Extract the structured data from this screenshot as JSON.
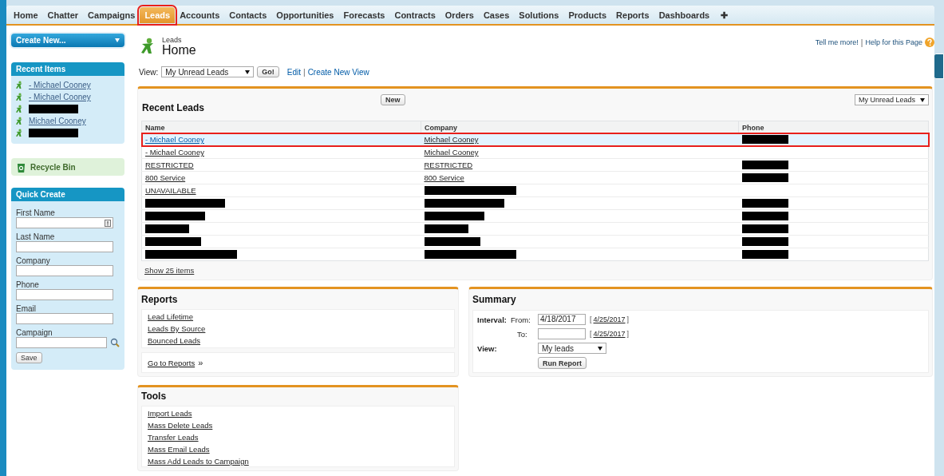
{
  "tabs": [
    {
      "label": "Home",
      "selected": false,
      "annotated": false
    },
    {
      "label": "Chatter",
      "selected": false,
      "annotated": false
    },
    {
      "label": "Campaigns",
      "selected": false,
      "annotated": false
    },
    {
      "label": "Leads",
      "selected": true,
      "annotated": true
    },
    {
      "label": "Accounts",
      "selected": false,
      "annotated": false
    },
    {
      "label": "Contacts",
      "selected": false,
      "annotated": false
    },
    {
      "label": "Opportunities",
      "selected": false,
      "annotated": false
    },
    {
      "label": "Forecasts",
      "selected": false,
      "annotated": false
    },
    {
      "label": "Contracts",
      "selected": false,
      "annotated": false
    },
    {
      "label": "Orders",
      "selected": false,
      "annotated": false
    },
    {
      "label": "Cases",
      "selected": false,
      "annotated": false
    },
    {
      "label": "Solutions",
      "selected": false,
      "annotated": false
    },
    {
      "label": "Products",
      "selected": false,
      "annotated": false
    },
    {
      "label": "Reports",
      "selected": false,
      "annotated": false
    },
    {
      "label": "Dashboards",
      "selected": false,
      "annotated": false
    }
  ],
  "add_tab": "✚",
  "sidebar": {
    "create_button": "Create New...",
    "recent_items": {
      "title": "Recent Items",
      "items": [
        {
          "kind": "link",
          "label": "- Michael Cooney"
        },
        {
          "kind": "link",
          "label": "- Michael Cooney"
        },
        {
          "kind": "redacted"
        },
        {
          "kind": "link",
          "label": "Michael Cooney"
        },
        {
          "kind": "redacted"
        }
      ]
    },
    "recycle_bin": "Recycle Bin",
    "quick_create": {
      "title": "Quick Create",
      "fields": [
        {
          "label": "First Name",
          "kind": "required"
        },
        {
          "label": "Last Name",
          "kind": "text"
        },
        {
          "label": "Company",
          "kind": "text"
        },
        {
          "label": "Phone",
          "kind": "text"
        },
        {
          "label": "Email",
          "kind": "text"
        },
        {
          "label": "Campaign",
          "kind": "lookup"
        }
      ],
      "save": "Save"
    }
  },
  "header": {
    "object": "Leads",
    "title": "Home",
    "help_links": [
      "Tell me more!",
      "Help for this Page"
    ],
    "separator": "|"
  },
  "view": {
    "label": "View:",
    "value": "My Unread Leads",
    "go": "Go!",
    "links": [
      "Edit",
      "Create New View"
    ],
    "separator": "|"
  },
  "recent_leads": {
    "title": "Recent Leads",
    "new_button": "New",
    "filter": "My Unread Leads",
    "columns": [
      "Name",
      "Company",
      "Phone"
    ],
    "rows": [
      {
        "selected": true,
        "annotated": true,
        "cells": [
          {
            "kind": "link",
            "text": "- Michael Cooney"
          },
          {
            "kind": "link",
            "text": "Michael Cooney"
          },
          {
            "kind": "redacted"
          }
        ]
      },
      {
        "selected": false,
        "annotated": false,
        "cells": [
          {
            "kind": "link",
            "text": "- Michael Cooney"
          },
          {
            "kind": "link",
            "text": "Michael Cooney"
          },
          {
            "kind": "empty"
          }
        ]
      },
      {
        "selected": false,
        "annotated": false,
        "cells": [
          {
            "kind": "link",
            "text": "RESTRICTED"
          },
          {
            "kind": "link",
            "text": "RESTRICTED"
          },
          {
            "kind": "redacted"
          }
        ]
      },
      {
        "selected": false,
        "annotated": false,
        "cells": [
          {
            "kind": "link",
            "text": "800 Service"
          },
          {
            "kind": "link",
            "text": "800 Service"
          },
          {
            "kind": "redacted"
          }
        ]
      },
      {
        "selected": false,
        "annotated": false,
        "cells": [
          {
            "kind": "link",
            "text": "UNAVAILABLE"
          },
          {
            "kind": "redacted"
          },
          {
            "kind": "empty"
          }
        ]
      },
      {
        "selected": false,
        "annotated": false,
        "cells": [
          {
            "kind": "redacted"
          },
          {
            "kind": "redacted"
          },
          {
            "kind": "redacted"
          }
        ]
      },
      {
        "selected": false,
        "annotated": false,
        "cells": [
          {
            "kind": "redacted"
          },
          {
            "kind": "redacted"
          },
          {
            "kind": "redacted"
          }
        ]
      },
      {
        "selected": false,
        "annotated": false,
        "cells": [
          {
            "kind": "redacted"
          },
          {
            "kind": "redacted"
          },
          {
            "kind": "redacted"
          }
        ]
      },
      {
        "selected": false,
        "annotated": false,
        "cells": [
          {
            "kind": "redacted"
          },
          {
            "kind": "redacted"
          },
          {
            "kind": "redacted"
          }
        ]
      },
      {
        "selected": false,
        "annotated": false,
        "cells": [
          {
            "kind": "redacted"
          },
          {
            "kind": "redacted"
          },
          {
            "kind": "redacted"
          }
        ]
      }
    ],
    "show_more": "Show 25 items"
  },
  "reports": {
    "title": "Reports",
    "links": [
      "Lead Lifetime",
      "Leads By Source",
      "Bounced Leads"
    ],
    "footer_link": "Go to Reports",
    "footer_mark": "»"
  },
  "summary": {
    "title": "Summary",
    "interval_label": "Interval:",
    "from_label": "From:",
    "from_value": "4/18/2017",
    "from_today": [
      "[",
      "4/25/2017",
      "]"
    ],
    "to_label": "To:",
    "to_today": [
      "[",
      "4/25/2017",
      "]"
    ],
    "view_label": "View:",
    "view_value": "My leads",
    "run_button": "Run Report"
  },
  "tools": {
    "title": "Tools",
    "links": [
      "Import Leads",
      "Mass Delete Leads",
      "Transfer Leads",
      "Mass Email Leads",
      "Mass Add Leads to Campaign"
    ]
  }
}
